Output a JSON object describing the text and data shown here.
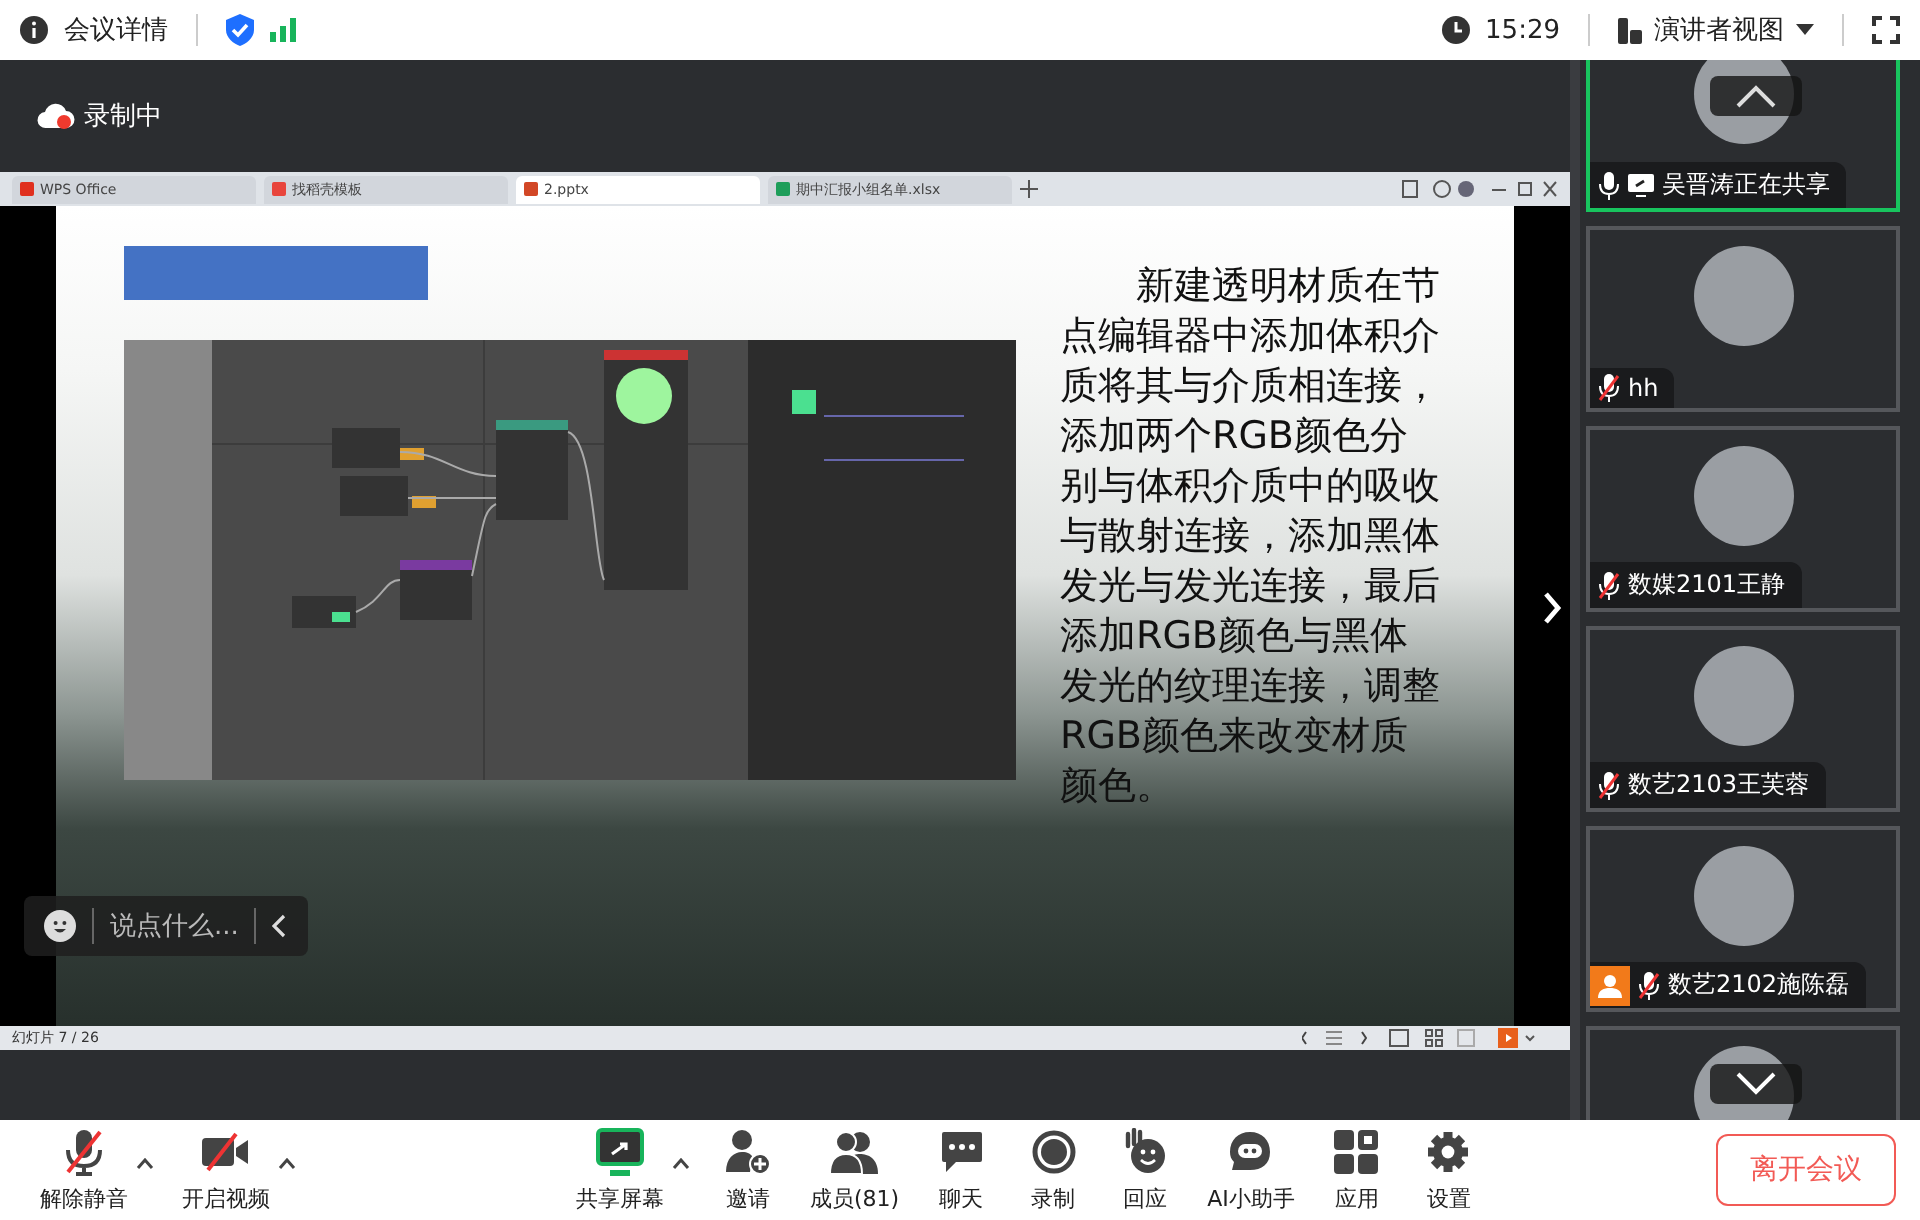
{
  "top_bar": {
    "title": "会议详情",
    "time": "15:29",
    "view_menu": "演讲者视图"
  },
  "recording": {
    "label": "录制中"
  },
  "shared_window": {
    "tabs": [
      {
        "label": "WPS Office",
        "kind": "wps",
        "selected": false
      },
      {
        "label": "找稻壳模板",
        "kind": "docer",
        "selected": false
      },
      {
        "label": "2.pptx",
        "kind": "ppt",
        "selected": true
      },
      {
        "label": "期中汇报小组名单.xlsx",
        "kind": "xls",
        "selected": false
      }
    ],
    "slide": {
      "paragraph": "新建透明材质在节点编辑器中添加体积介质将其与介质相连接，添加两个RGB颜色分别与体积介质中的吸收与散射连接，添加黑体发光与发光连接，最后添加RGB颜色与黑体发光的纹理连接，调整RGB颜色来改变材质颜色。"
    },
    "chat_placeholder": "说点什么...",
    "status": "幻灯片 7 / 26"
  },
  "participants": [
    {
      "name": "吴晋涛正在共享",
      "muted": false,
      "sharing": true,
      "speaking": true,
      "avatar_badge": false
    },
    {
      "name": "hh",
      "muted": true,
      "sharing": false,
      "speaking": false,
      "avatar_badge": false
    },
    {
      "name": "数媒2101王静",
      "muted": true,
      "sharing": false,
      "speaking": false,
      "avatar_badge": false
    },
    {
      "name": "数艺2103王芙蓉",
      "muted": true,
      "sharing": false,
      "speaking": false,
      "avatar_badge": false
    },
    {
      "name": "数艺2102施陈磊",
      "muted": true,
      "sharing": false,
      "speaking": false,
      "avatar_badge": true
    }
  ],
  "toolbar": [
    {
      "kind": "mic",
      "label": "解除静音",
      "menu": true
    },
    {
      "kind": "camera",
      "label": "开启视频",
      "menu": true
    },
    {
      "kind": "share",
      "label": "共享屏幕",
      "menu": true
    },
    {
      "kind": "invite",
      "label": "邀请",
      "menu": false
    },
    {
      "kind": "members",
      "label": "成员(81)",
      "menu": false
    },
    {
      "kind": "chat",
      "label": "聊天",
      "menu": false
    },
    {
      "kind": "record",
      "label": "录制",
      "menu": false
    },
    {
      "kind": "react",
      "label": "回应",
      "menu": false
    },
    {
      "kind": "ai",
      "label": "AI小助手",
      "menu": false
    },
    {
      "kind": "apps",
      "label": "应用",
      "menu": false
    },
    {
      "kind": "settings",
      "label": "设置",
      "menu": false
    }
  ],
  "leave_button": "离开会议"
}
